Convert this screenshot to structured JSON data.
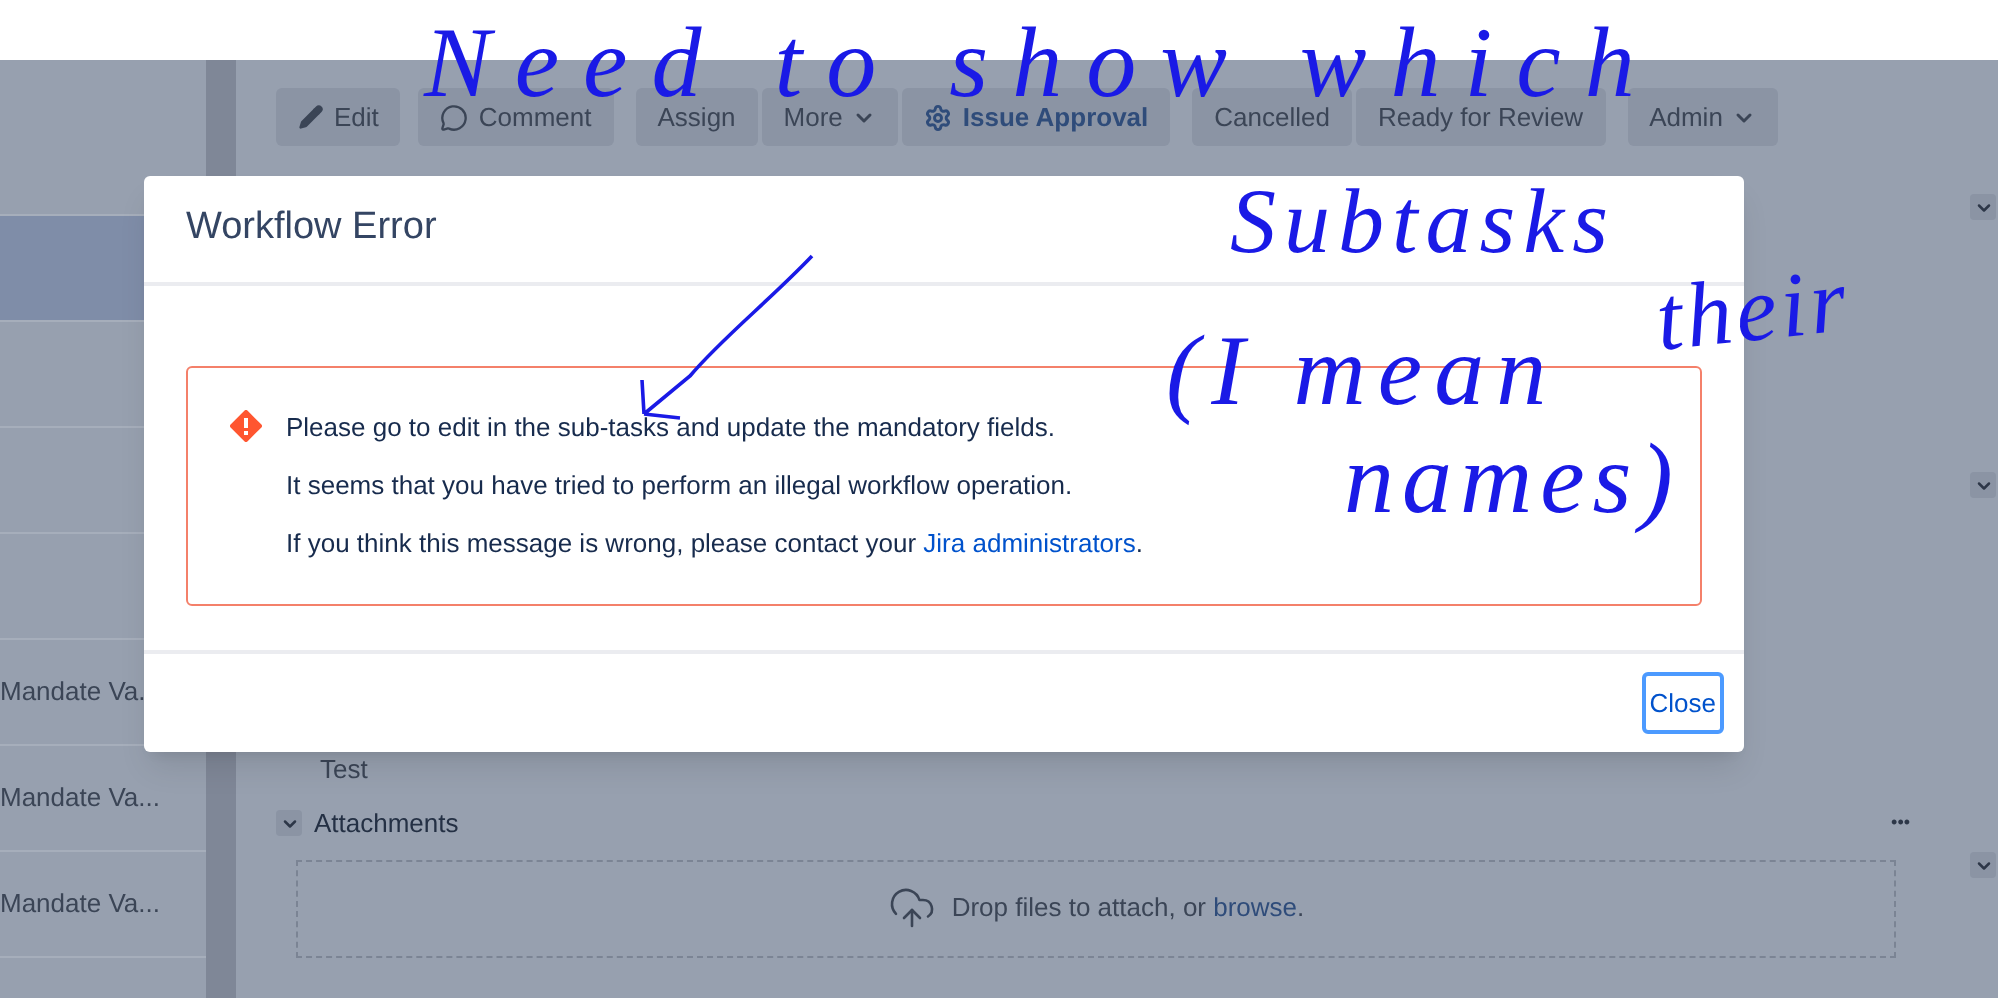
{
  "sidebar": {
    "items": [
      {
        "selected": false
      },
      {
        "selected": true
      },
      {
        "selected": false
      },
      {
        "selected": false
      },
      {
        "selected": false
      },
      {
        "label": "Mandate Va.",
        "selected": false
      },
      {
        "label": "Mandate Va...",
        "selected": false
      },
      {
        "label": "Mandate Va...",
        "selected": false
      }
    ]
  },
  "toolbar": {
    "buttons": [
      {
        "label": "Edit",
        "kind": "edit"
      },
      {
        "label": "Comment",
        "kind": "comment"
      },
      {
        "label": "Assign",
        "kind": "plain"
      },
      {
        "label": "More",
        "kind": "menu"
      },
      {
        "label": "Issue Approval",
        "kind": "approval"
      },
      {
        "label": "Cancelled",
        "kind": "plain"
      },
      {
        "label": "Ready for Review",
        "kind": "plain"
      },
      {
        "label": "Admin",
        "kind": "menu"
      }
    ]
  },
  "description": {
    "text": "Test"
  },
  "attachments": {
    "title": "Attachments",
    "more": "•••",
    "drop_text": "Drop files to attach, or ",
    "browse_link": "browse",
    "drop_end": "."
  },
  "dialog": {
    "title": "Workflow Error",
    "messages": [
      "Please go to edit in the sub-tasks and update the mandatory fields.",
      "It seems that you have tried to perform an illegal workflow operation."
    ],
    "contact_text": "If you think this message is wrong, please contact your ",
    "contact_link": "Jira administrators",
    "contact_end": ".",
    "close": "Close"
  },
  "annotations": [
    {
      "text": "Need to show which"
    },
    {
      "text": "Subtasks"
    },
    {
      "text": "their"
    },
    {
      "text": "(I mean"
    },
    {
      "text": "names)"
    }
  ]
}
